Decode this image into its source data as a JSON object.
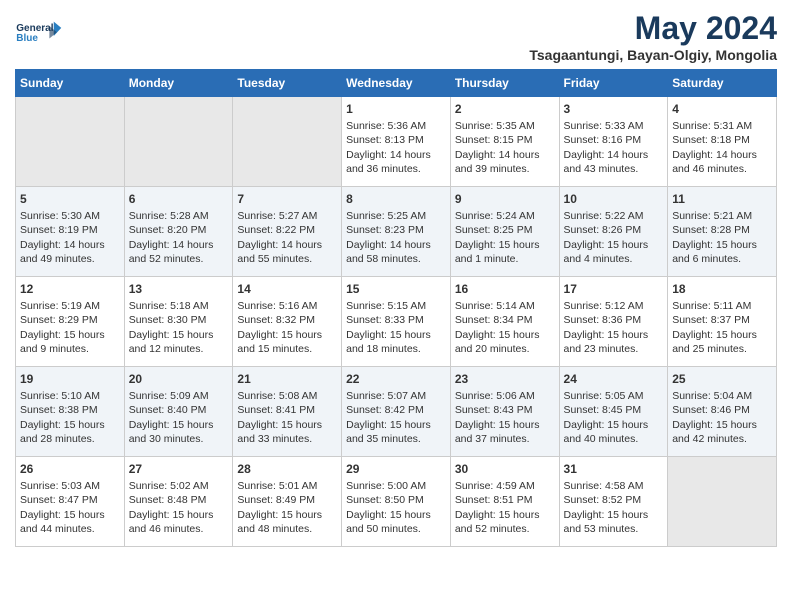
{
  "header": {
    "logo_line1": "General",
    "logo_line2": "Blue",
    "main_title": "May 2024",
    "subtitle": "Tsagaantungi, Bayan-Olgiy, Mongolia"
  },
  "calendar": {
    "days_of_week": [
      "Sunday",
      "Monday",
      "Tuesday",
      "Wednesday",
      "Thursday",
      "Friday",
      "Saturday"
    ],
    "weeks": [
      [
        {
          "day": "",
          "info": ""
        },
        {
          "day": "",
          "info": ""
        },
        {
          "day": "",
          "info": ""
        },
        {
          "day": "1",
          "info": "Sunrise: 5:36 AM\nSunset: 8:13 PM\nDaylight: 14 hours\nand 36 minutes."
        },
        {
          "day": "2",
          "info": "Sunrise: 5:35 AM\nSunset: 8:15 PM\nDaylight: 14 hours\nand 39 minutes."
        },
        {
          "day": "3",
          "info": "Sunrise: 5:33 AM\nSunset: 8:16 PM\nDaylight: 14 hours\nand 43 minutes."
        },
        {
          "day": "4",
          "info": "Sunrise: 5:31 AM\nSunset: 8:18 PM\nDaylight: 14 hours\nand 46 minutes."
        }
      ],
      [
        {
          "day": "5",
          "info": "Sunrise: 5:30 AM\nSunset: 8:19 PM\nDaylight: 14 hours\nand 49 minutes."
        },
        {
          "day": "6",
          "info": "Sunrise: 5:28 AM\nSunset: 8:20 PM\nDaylight: 14 hours\nand 52 minutes."
        },
        {
          "day": "7",
          "info": "Sunrise: 5:27 AM\nSunset: 8:22 PM\nDaylight: 14 hours\nand 55 minutes."
        },
        {
          "day": "8",
          "info": "Sunrise: 5:25 AM\nSunset: 8:23 PM\nDaylight: 14 hours\nand 58 minutes."
        },
        {
          "day": "9",
          "info": "Sunrise: 5:24 AM\nSunset: 8:25 PM\nDaylight: 15 hours\nand 1 minute."
        },
        {
          "day": "10",
          "info": "Sunrise: 5:22 AM\nSunset: 8:26 PM\nDaylight: 15 hours\nand 4 minutes."
        },
        {
          "day": "11",
          "info": "Sunrise: 5:21 AM\nSunset: 8:28 PM\nDaylight: 15 hours\nand 6 minutes."
        }
      ],
      [
        {
          "day": "12",
          "info": "Sunrise: 5:19 AM\nSunset: 8:29 PM\nDaylight: 15 hours\nand 9 minutes."
        },
        {
          "day": "13",
          "info": "Sunrise: 5:18 AM\nSunset: 8:30 PM\nDaylight: 15 hours\nand 12 minutes."
        },
        {
          "day": "14",
          "info": "Sunrise: 5:16 AM\nSunset: 8:32 PM\nDaylight: 15 hours\nand 15 minutes."
        },
        {
          "day": "15",
          "info": "Sunrise: 5:15 AM\nSunset: 8:33 PM\nDaylight: 15 hours\nand 18 minutes."
        },
        {
          "day": "16",
          "info": "Sunrise: 5:14 AM\nSunset: 8:34 PM\nDaylight: 15 hours\nand 20 minutes."
        },
        {
          "day": "17",
          "info": "Sunrise: 5:12 AM\nSunset: 8:36 PM\nDaylight: 15 hours\nand 23 minutes."
        },
        {
          "day": "18",
          "info": "Sunrise: 5:11 AM\nSunset: 8:37 PM\nDaylight: 15 hours\nand 25 minutes."
        }
      ],
      [
        {
          "day": "19",
          "info": "Sunrise: 5:10 AM\nSunset: 8:38 PM\nDaylight: 15 hours\nand 28 minutes."
        },
        {
          "day": "20",
          "info": "Sunrise: 5:09 AM\nSunset: 8:40 PM\nDaylight: 15 hours\nand 30 minutes."
        },
        {
          "day": "21",
          "info": "Sunrise: 5:08 AM\nSunset: 8:41 PM\nDaylight: 15 hours\nand 33 minutes."
        },
        {
          "day": "22",
          "info": "Sunrise: 5:07 AM\nSunset: 8:42 PM\nDaylight: 15 hours\nand 35 minutes."
        },
        {
          "day": "23",
          "info": "Sunrise: 5:06 AM\nSunset: 8:43 PM\nDaylight: 15 hours\nand 37 minutes."
        },
        {
          "day": "24",
          "info": "Sunrise: 5:05 AM\nSunset: 8:45 PM\nDaylight: 15 hours\nand 40 minutes."
        },
        {
          "day": "25",
          "info": "Sunrise: 5:04 AM\nSunset: 8:46 PM\nDaylight: 15 hours\nand 42 minutes."
        }
      ],
      [
        {
          "day": "26",
          "info": "Sunrise: 5:03 AM\nSunset: 8:47 PM\nDaylight: 15 hours\nand 44 minutes."
        },
        {
          "day": "27",
          "info": "Sunrise: 5:02 AM\nSunset: 8:48 PM\nDaylight: 15 hours\nand 46 minutes."
        },
        {
          "day": "28",
          "info": "Sunrise: 5:01 AM\nSunset: 8:49 PM\nDaylight: 15 hours\nand 48 minutes."
        },
        {
          "day": "29",
          "info": "Sunrise: 5:00 AM\nSunset: 8:50 PM\nDaylight: 15 hours\nand 50 minutes."
        },
        {
          "day": "30",
          "info": "Sunrise: 4:59 AM\nSunset: 8:51 PM\nDaylight: 15 hours\nand 52 minutes."
        },
        {
          "day": "31",
          "info": "Sunrise: 4:58 AM\nSunset: 8:52 PM\nDaylight: 15 hours\nand 53 minutes."
        },
        {
          "day": "",
          "info": ""
        }
      ]
    ]
  }
}
